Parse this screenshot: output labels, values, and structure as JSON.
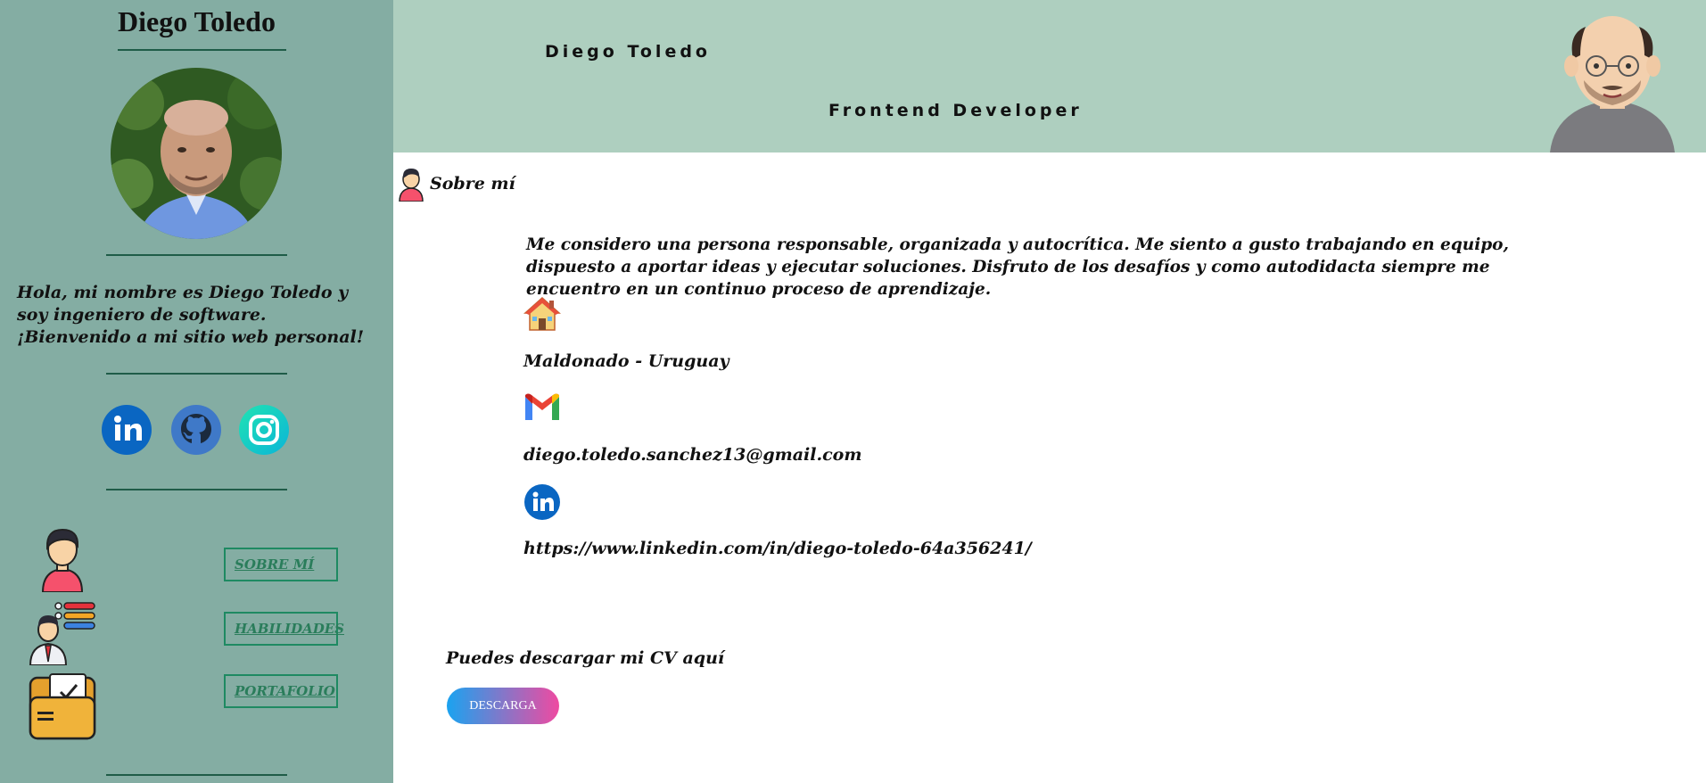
{
  "sidebar": {
    "name": "Diego Toledo",
    "intro": "Hola, mi nombre es Diego Toledo y soy ingeniero de software. ¡Bienvenido a mi sitio web personal!",
    "social": [
      {
        "icon": "linkedin-icon",
        "color": "#0a66c2"
      },
      {
        "icon": "github-icon",
        "color": "#3f79c8"
      },
      {
        "icon": "instagram-icon",
        "color": "#1cd1b8"
      }
    ],
    "nav": [
      {
        "label": "SOBRE MÍ",
        "icon": "person-icon"
      },
      {
        "label": "HABILIDADES",
        "icon": "skills-icon"
      },
      {
        "label": "PORTAFOLIO",
        "icon": "folder-icon"
      }
    ]
  },
  "header": {
    "name": "Diego Toledo",
    "role": "Frontend Developer",
    "avatar_icon": "cartoon-avatar-icon"
  },
  "main": {
    "section_title": "Sobre mí",
    "about": "Me considero una persona responsable, organizada y autocrítica. Me siento a gusto trabajando en equipo, dispuesto a aportar ideas y ejecutar soluciones. Disfruto de los desafíos y como autodidacta siempre me encuentro en un continuo proceso de aprendizaje.",
    "location": "Maldonado - Uruguay",
    "email": "diego.toledo.sanchez13@gmail.com",
    "linkedin": "https://www.linkedin.com/in/diego-toledo-64a356241/",
    "cv_label": "Puedes descargar mi CV aquí",
    "cv_button": "DESCARGA"
  },
  "colors": {
    "sidebar_bg": "#84ada3",
    "header_bg": "#aecfbf",
    "nav_border": "#1e8a62",
    "divider": "#1f5c48"
  }
}
